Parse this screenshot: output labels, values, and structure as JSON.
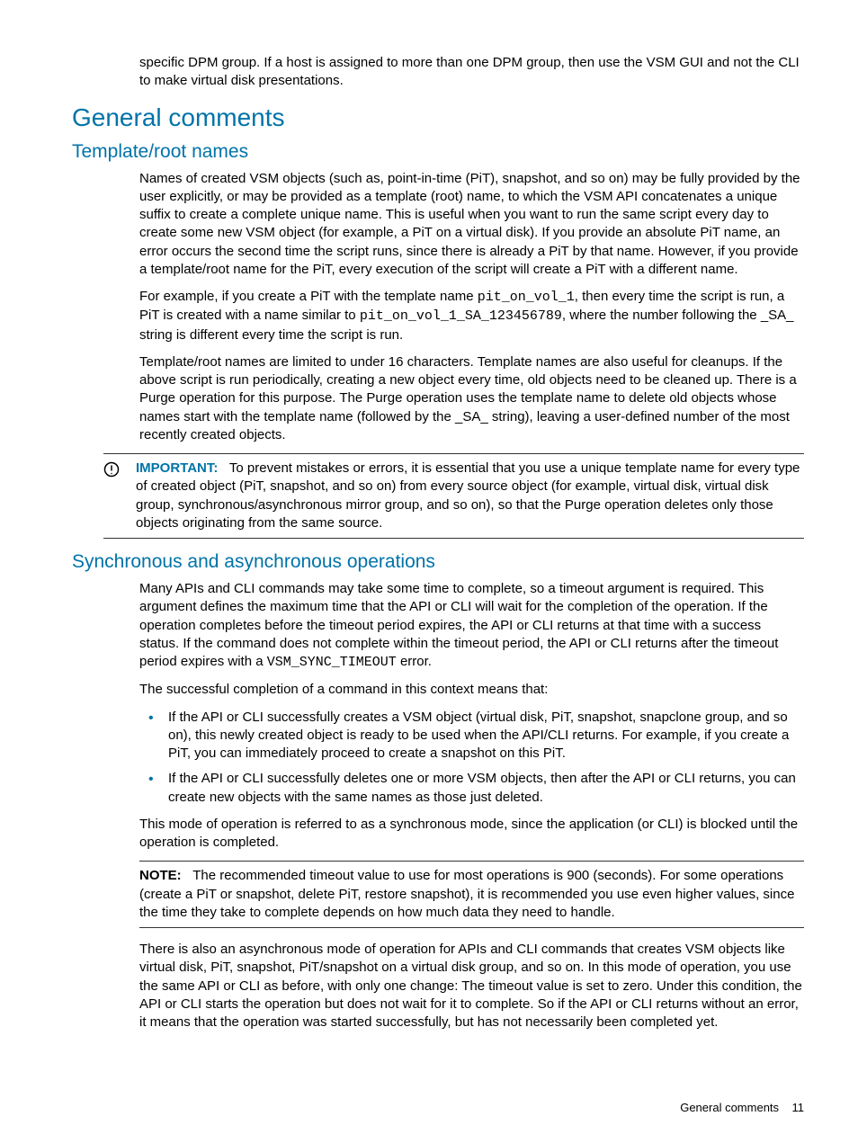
{
  "lead_para": "specific DPM group. If a host is assigned to more than one DPM group, then use the VSM GUI and not the CLI to make virtual disk presentations.",
  "h1": "General comments",
  "sec1": {
    "heading": "Template/root names",
    "p1": "Names of created VSM objects (such as, point-in-time (PiT), snapshot, and so on) may be fully provided by the user explicitly, or may be provided as a template (root) name, to which the VSM API concatenates a unique suffix to create a complete unique name. This is useful when you want to run the same script every day to create some new VSM object (for example, a PiT on a virtual disk). If you provide an absolute PiT name, an error occurs the second time the script runs, since there is already a PiT by that name. However, if you provide a template/root name for the PiT, every execution of the script will create a PiT with a different name.",
    "p2_a": "For example, if you create a PiT with the template name ",
    "p2_code1": "pit_on_vol_1",
    "p2_b": ", then every time the script is run, a PiT is created with a name similar to ",
    "p2_code2": "pit_on_vol_1_SA_123456789",
    "p2_c": ", where the number following the _SA_ string is different every time the script is run.",
    "p3": "Template/root names are limited to under 16 characters. Template names are also useful for cleanups. If the above script is run periodically, creating a new object every time, old objects need to be cleaned up. There is a Purge operation for this purpose. The Purge operation uses the template name to delete old objects whose names start with the template name (followed by the _SA_ string), leaving a user-defined number of the most recently created objects.",
    "important_label": "IMPORTANT:",
    "important_body": "To prevent mistakes or errors, it is essential that you use a unique template name for every type of created object (PiT, snapshot, and so on) from every source object (for example, virtual disk, virtual disk group, synchronous/asynchronous mirror group, and so on), so that the Purge operation deletes only those objects originating from the same source."
  },
  "sec2": {
    "heading": "Synchronous and asynchronous operations",
    "p1_a": "Many APIs and CLI commands may take some time to complete, so a timeout argument is required. This argument defines the maximum time that the API or CLI will wait for the completion of the operation. If the operation completes before the timeout period expires, the API or CLI returns at that time with a success status. If the command does not complete within the timeout period, the API or CLI returns after the timeout period expires with a ",
    "p1_code": "VSM_SYNC_TIMEOUT",
    "p1_b": " error.",
    "p2": "The successful completion of a command in this context means that:",
    "bullets": [
      "If the API or CLI successfully creates a VSM object (virtual disk, PiT, snapshot, snapclone group, and so on), this newly created object is ready to be used when the API/CLI returns. For example, if you create a PiT, you can immediately proceed to create a snapshot on this PiT.",
      "If the API or CLI successfully deletes one or more VSM objects, then after the API or CLI returns, you can create new objects with the same names as those just deleted."
    ],
    "p3": "This mode of operation is referred to as a synchronous mode, since the application (or CLI) is blocked until the operation is completed.",
    "note_label": "NOTE:",
    "note_body": "The recommended timeout value to use for most operations is 900 (seconds). For some operations (create a PiT or snapshot, delete PiT, restore snapshot), it is recommended you use even higher values, since the time they take to complete depends on how much data they need to handle.",
    "p4": "There is also an asynchronous mode of operation for APIs and CLI commands that creates VSM objects like virtual disk, PiT, snapshot, PiT/snapshot on a virtual disk group, and so on. In this mode of operation, you use the same API or CLI as before, with only one change: The timeout value is set to zero. Under this condition, the API or CLI starts the operation but does not wait for it to complete. So if the API or CLI returns without an error, it means that the operation was started successfully, but has not necessarily been completed yet."
  },
  "footer_text": "General comments",
  "footer_page": "11"
}
